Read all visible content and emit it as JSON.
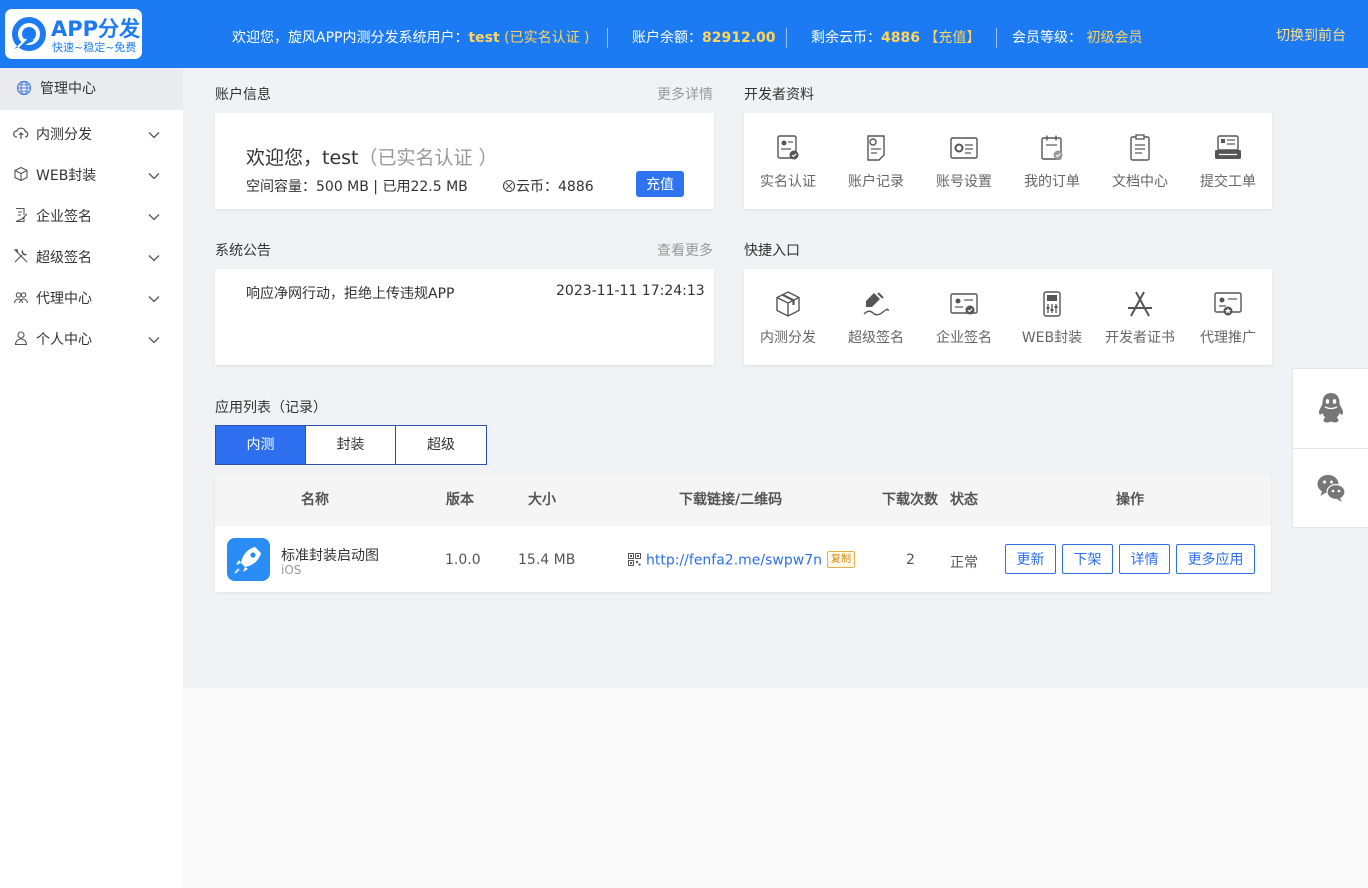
{
  "logo": {
    "title": "APP分发",
    "subtitle": "快速~稳定~免费"
  },
  "header": {
    "welcome_prefix": "欢迎您，旋风APP内测分发系统用户：",
    "username": "test",
    "verify_status": "(已实名认证 )",
    "balance_label": "账户余额：",
    "balance_value": "82912.00",
    "coins_label": "剩余云币：",
    "coins_value": "4886",
    "recharge_link": "【充值】",
    "level_label": "会员等级：",
    "level_value": "初级会员",
    "switch_front": "切换到前台"
  },
  "sidebar": {
    "home": "管理中心",
    "items": [
      {
        "label": "内测分发",
        "icon": "cloud-upload-icon"
      },
      {
        "label": "WEB封装",
        "icon": "cube-icon"
      },
      {
        "label": "企业签名",
        "icon": "document-sign-icon"
      },
      {
        "label": "超级签名",
        "icon": "tools-icon"
      },
      {
        "label": "代理中心",
        "icon": "group-icon"
      },
      {
        "label": "个人中心",
        "icon": "user-icon"
      }
    ]
  },
  "account": {
    "title": "账户信息",
    "more": "更多详情",
    "welcome": "欢迎您，test",
    "verify": "（已实名认证 ）",
    "space": "空间容量：500 MB | 已用22.5 MB",
    "coin": "云币：4886",
    "recharge": "充值"
  },
  "developer": {
    "title": "开发者资料",
    "items": [
      {
        "label": "实名认证",
        "icon": "id-verify-icon"
      },
      {
        "label": "账户记录",
        "icon": "account-record-icon"
      },
      {
        "label": "账号设置",
        "icon": "account-settings-icon"
      },
      {
        "label": "我的订单",
        "icon": "orders-icon"
      },
      {
        "label": "文档中心",
        "icon": "docs-icon"
      },
      {
        "label": "提交工单",
        "icon": "ticket-icon"
      }
    ]
  },
  "notice": {
    "title": "系统公告",
    "more": "查看更多",
    "text": "响应净网行动，拒绝上传违规APP",
    "date": "2023-11-11 17:24:13"
  },
  "shortcut": {
    "title": "快捷入口",
    "items": [
      {
        "label": "内测分发",
        "icon": "distribution-icon"
      },
      {
        "label": "超级签名",
        "icon": "super-sign-icon"
      },
      {
        "label": "企业签名",
        "icon": "enterprise-sign-icon"
      },
      {
        "label": "WEB封装",
        "icon": "web-package-icon"
      },
      {
        "label": "开发者证书",
        "icon": "appstore-cert-icon"
      },
      {
        "label": "代理推广",
        "icon": "agent-promo-icon"
      }
    ]
  },
  "app_list": {
    "title": "应用列表（记录）",
    "tabs": [
      "内测",
      "封装",
      "超级"
    ],
    "active_tab": 0,
    "columns": {
      "name": "名称",
      "version": "版本",
      "size": "大小",
      "link": "下载链接/二维码",
      "downloads": "下载次数",
      "status": "状态",
      "ops": "操作"
    },
    "rows": [
      {
        "name": "标准封装启动图",
        "platform": "iOS",
        "version": "1.0.0",
        "size": "15.4 MB",
        "link": "http://fenfa2.me/swpw7n",
        "copy": "复制",
        "downloads": "2",
        "status": "正常",
        "actions": [
          "更新",
          "下架",
          "详情",
          "更多应用"
        ]
      }
    ]
  },
  "colors": {
    "header_bg": "#1c7bf2",
    "accent": "#2e6ff0",
    "highlight": "#ffd45c"
  }
}
